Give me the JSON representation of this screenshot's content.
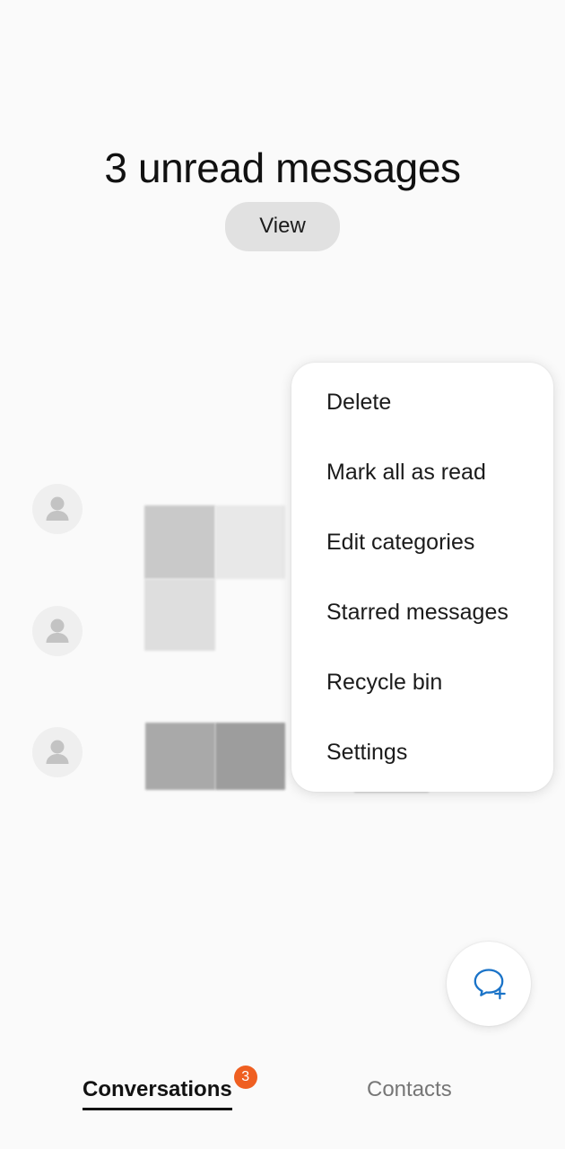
{
  "background_color": "#fafafa",
  "header": {
    "title": "3 unread messages",
    "view_label": "View"
  },
  "conversation_list": {
    "rows": [
      {
        "avatar_icon": "person-icon"
      },
      {
        "avatar_icon": "person-icon"
      },
      {
        "avatar_icon": "person-icon"
      }
    ]
  },
  "overflow_menu": {
    "items": [
      {
        "label": "Delete"
      },
      {
        "label": "Mark all as read"
      },
      {
        "label": "Edit categories"
      },
      {
        "label": "Starred messages"
      },
      {
        "label": "Recycle bin"
      },
      {
        "label": "Settings"
      }
    ]
  },
  "fab": {
    "icon": "new-message-icon",
    "color": "#1a73c8"
  },
  "tabbar": {
    "tabs": [
      {
        "label": "Conversations",
        "active": true,
        "badge": "3"
      },
      {
        "label": "Contacts",
        "active": false,
        "badge": ""
      }
    ],
    "badge_color": "#ef5f21"
  }
}
